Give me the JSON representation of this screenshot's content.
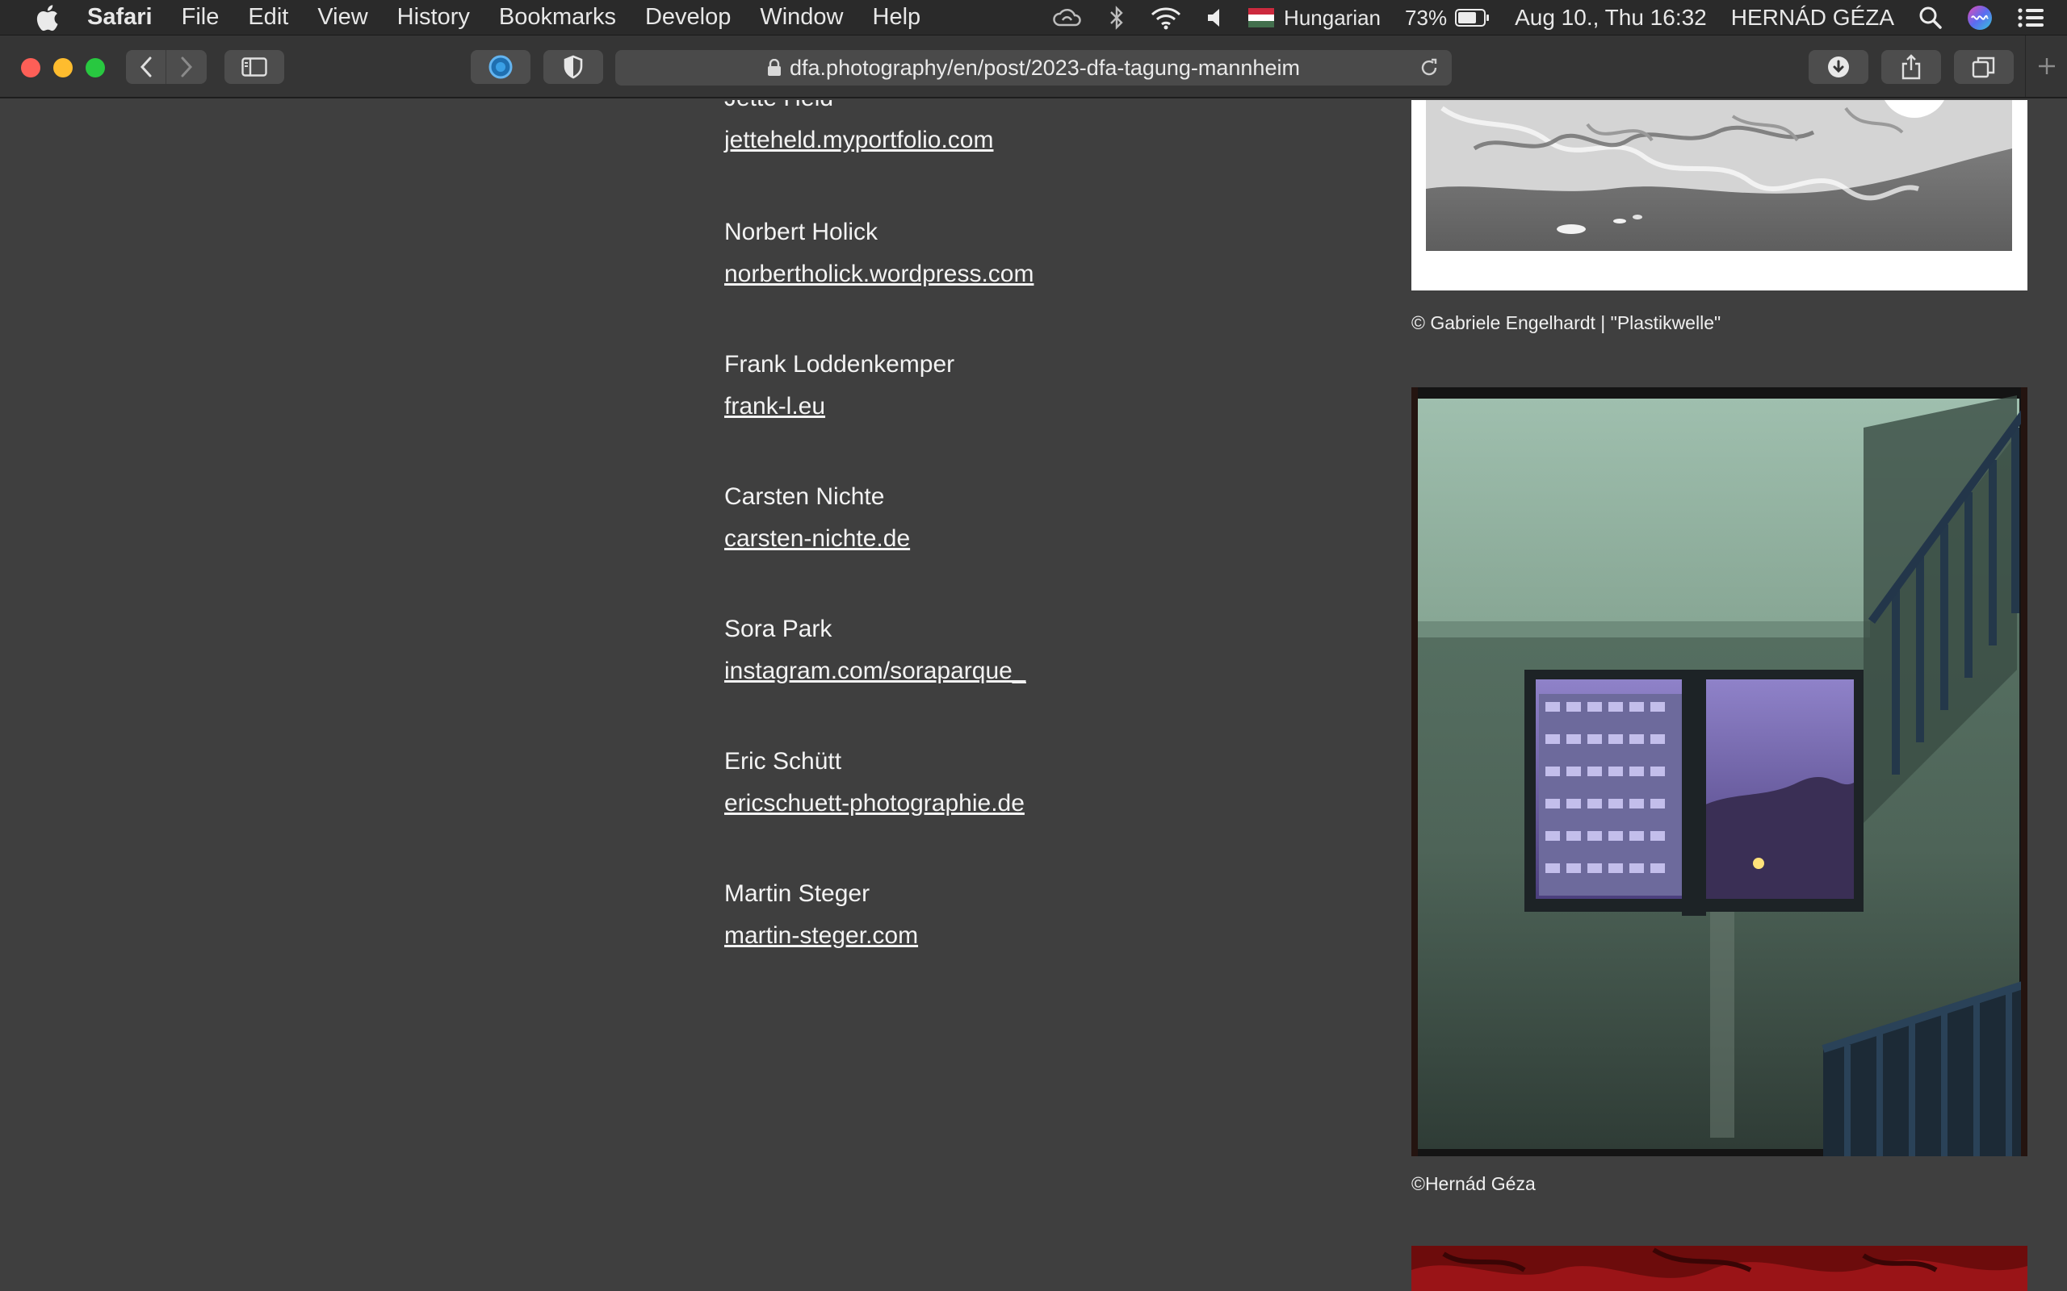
{
  "menubar": {
    "app": "Safari",
    "items": [
      "File",
      "Edit",
      "View",
      "History",
      "Bookmarks",
      "Develop",
      "Window",
      "Help"
    ],
    "input_source": "Hungarian",
    "battery": "73%",
    "datetime": "Aug 10., Thu  16:32",
    "user": "HERNÁD GÉZA"
  },
  "browser": {
    "url": "dfa.photography/en/post/2023-dfa-tagung-mannheim"
  },
  "contacts": [
    {
      "name": "Jette Held",
      "link": "jetteheld.myportfolio.com"
    },
    {
      "name": "Norbert Holick",
      "link": "norbertholick.wordpress.com"
    },
    {
      "name": "Frank Loddenkemper",
      "link": "frank-l.eu"
    },
    {
      "name": "Carsten Nichte",
      "link": "carsten-nichte.de"
    },
    {
      "name": "Sora Park",
      "link": "instagram.com/soraparque_"
    },
    {
      "name": "Eric Schütt",
      "link": "ericschuett-photographie.de"
    },
    {
      "name": "Martin Steger",
      "link": "martin-steger.com"
    }
  ],
  "captions": {
    "top": "© Gabriele Engelhardt | \"Plastikwelle\"",
    "mid": "©Hernád Géza"
  },
  "colors": {
    "page_bg": "#3f3f3f",
    "menubar_bg": "#2a2a2a",
    "toolbar_bg": "#353535",
    "text": "#f3f3f3"
  }
}
